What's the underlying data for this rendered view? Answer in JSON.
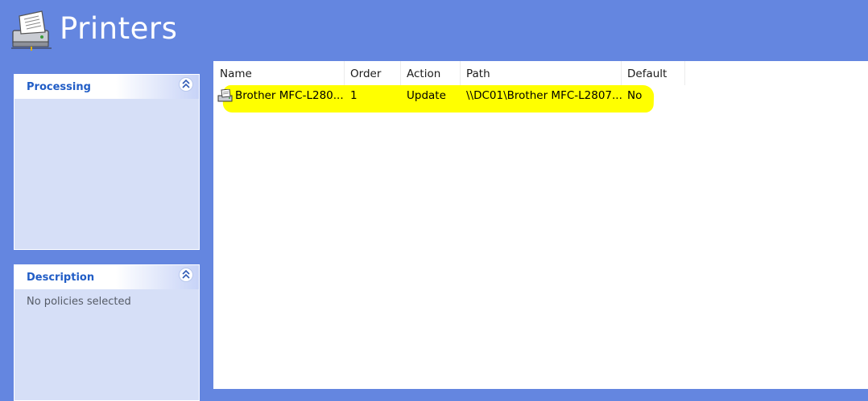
{
  "header": {
    "title": "Printers",
    "icon": "printer-icon"
  },
  "sidebar": {
    "processing": {
      "title": "Processing",
      "body": ""
    },
    "description": {
      "title": "Description",
      "body": "No policies selected"
    }
  },
  "table": {
    "columns": [
      "Name",
      "Order",
      "Action",
      "Path",
      "Default"
    ],
    "rows": [
      {
        "name": "Brother MFC-L280...",
        "order": "1",
        "action": "Update",
        "path": "\\\\DC01\\Brother MFC-L2807...",
        "default": "No"
      }
    ]
  },
  "colors": {
    "accent": "#6486e0",
    "highlight": "#ffff00",
    "panel_title": "#215dc6"
  }
}
